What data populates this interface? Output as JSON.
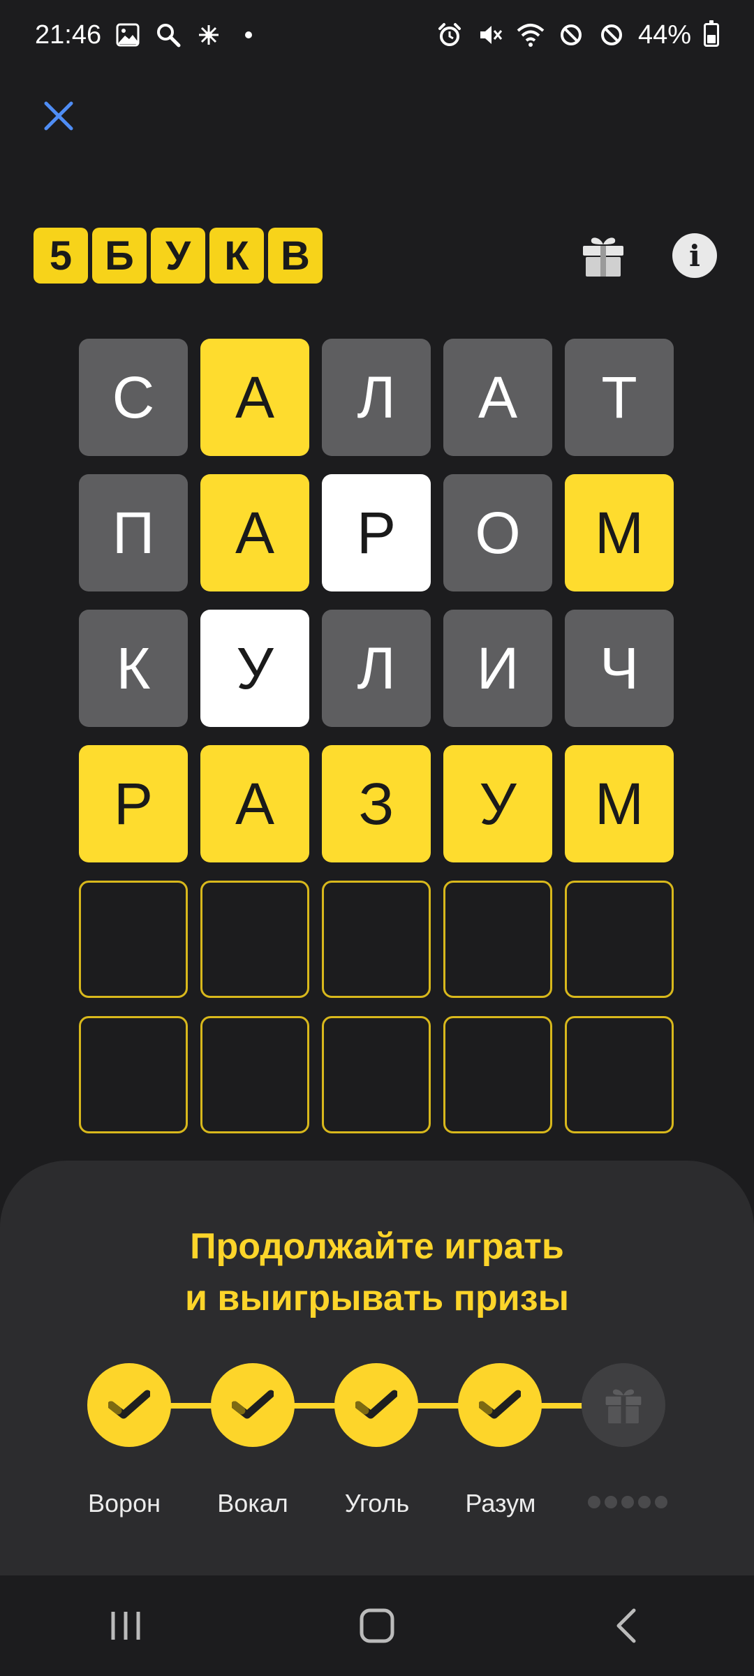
{
  "status_bar": {
    "time": "21:46",
    "battery_text": "44%",
    "left_icons": [
      "gallery-icon",
      "search-icon",
      "sparkle-icon",
      "dot-icon"
    ],
    "right_icons": [
      "alarm-icon",
      "mute-icon",
      "wifi-icon",
      "blocked-icon",
      "blocked-icon",
      "battery-icon"
    ]
  },
  "header": {
    "logo_letters": [
      "5",
      "Б",
      "У",
      "К",
      "В"
    ]
  },
  "grid": {
    "rows": [
      [
        {
          "letter": "С",
          "state": "absent"
        },
        {
          "letter": "А",
          "state": "correct"
        },
        {
          "letter": "Л",
          "state": "absent"
        },
        {
          "letter": "А",
          "state": "absent"
        },
        {
          "letter": "Т",
          "state": "absent"
        }
      ],
      [
        {
          "letter": "П",
          "state": "absent"
        },
        {
          "letter": "А",
          "state": "correct"
        },
        {
          "letter": "Р",
          "state": "present"
        },
        {
          "letter": "О",
          "state": "absent"
        },
        {
          "letter": "М",
          "state": "correct"
        }
      ],
      [
        {
          "letter": "К",
          "state": "absent"
        },
        {
          "letter": "У",
          "state": "present"
        },
        {
          "letter": "Л",
          "state": "absent"
        },
        {
          "letter": "И",
          "state": "absent"
        },
        {
          "letter": "Ч",
          "state": "absent"
        }
      ],
      [
        {
          "letter": "Р",
          "state": "correct"
        },
        {
          "letter": "А",
          "state": "correct"
        },
        {
          "letter": "З",
          "state": "correct"
        },
        {
          "letter": "У",
          "state": "correct"
        },
        {
          "letter": "М",
          "state": "correct"
        }
      ],
      [
        {
          "letter": "",
          "state": "empty"
        },
        {
          "letter": "",
          "state": "empty"
        },
        {
          "letter": "",
          "state": "empty"
        },
        {
          "letter": "",
          "state": "empty"
        },
        {
          "letter": "",
          "state": "empty"
        }
      ],
      [
        {
          "letter": "",
          "state": "empty"
        },
        {
          "letter": "",
          "state": "empty"
        },
        {
          "letter": "",
          "state": "empty"
        },
        {
          "letter": "",
          "state": "empty"
        },
        {
          "letter": "",
          "state": "empty"
        }
      ]
    ]
  },
  "sheet": {
    "title_line1": "Продолжайте играть",
    "title_line2": "и выигрывать призы",
    "steps": [
      {
        "label": "Ворон",
        "icon": "check-icon",
        "done": true
      },
      {
        "label": "Вокал",
        "icon": "check-icon",
        "done": true
      },
      {
        "label": "Уголь",
        "icon": "check-icon",
        "done": true
      },
      {
        "label": "Разум",
        "icon": "check-icon",
        "done": true
      },
      {
        "label": "",
        "icon": "gift-icon",
        "done": false
      }
    ]
  },
  "colors": {
    "background": "#1c1c1e",
    "accent_yellow": "#fedc2e",
    "absent_gray": "#5e5e60",
    "present_white": "#ffffff",
    "sheet": "#2c2c2e",
    "close_blue": "#4f8df5"
  }
}
